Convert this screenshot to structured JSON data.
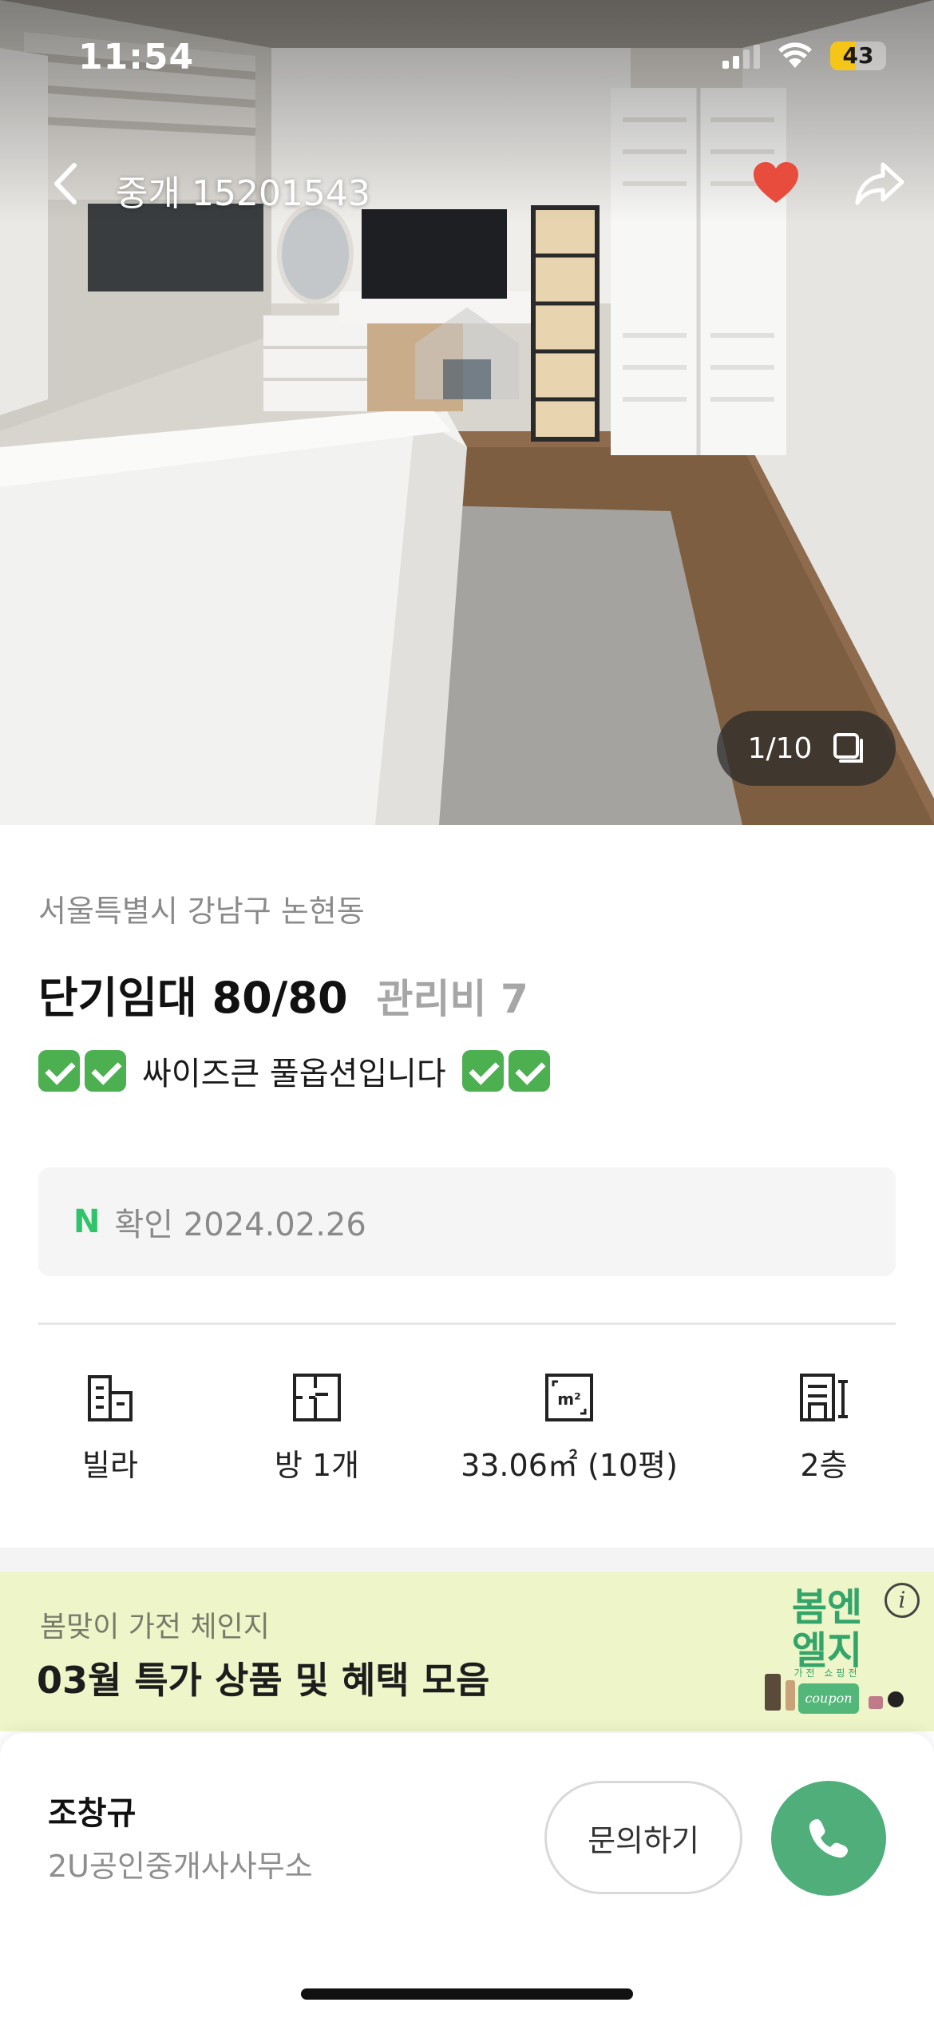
{
  "status_bar": {
    "time": "11:54",
    "battery": "43",
    "battery_color": "#f5c518"
  },
  "header": {
    "back_icon": "chevron-left-icon",
    "listing_id": "중개 15201543",
    "favorite_icon": "heart-icon",
    "favorite_color": "#e74c3c",
    "share_icon": "share-icon"
  },
  "gallery": {
    "counter": "1/10",
    "counter_icon": "gallery-stack-icon"
  },
  "listing": {
    "address": "서울특별시 강남구 논현동",
    "price": "단기임대 80/80",
    "maintenance_fee": "관리비 7",
    "headline": "싸이즈큰 풀옵션입니다",
    "verified_badge": "N",
    "verified_text": "확인 2024.02.26",
    "accent_color": "#2fc36a"
  },
  "specs": [
    {
      "icon": "building-icon",
      "label": "빌라"
    },
    {
      "icon": "floorplan-icon",
      "label": "방 1개"
    },
    {
      "icon": "area-icon",
      "label": "33.06㎡ (10평)"
    },
    {
      "icon": "floor-icon",
      "label": "2층"
    }
  ],
  "banner": {
    "subtitle": "봄맞이 가전 체인지",
    "title": "03월 특가 상품 및 혜택 모음",
    "brand": "봄엔\n엘지",
    "brand_sub": "가전 쇼핑전",
    "coupon": "coupon",
    "background": "#eef6c9"
  },
  "agent": {
    "name": "조창규",
    "office": "2U공인중개사사무소",
    "inquiry_label": "문의하기",
    "call_icon": "phone-icon",
    "call_color": "#4fae7a"
  }
}
